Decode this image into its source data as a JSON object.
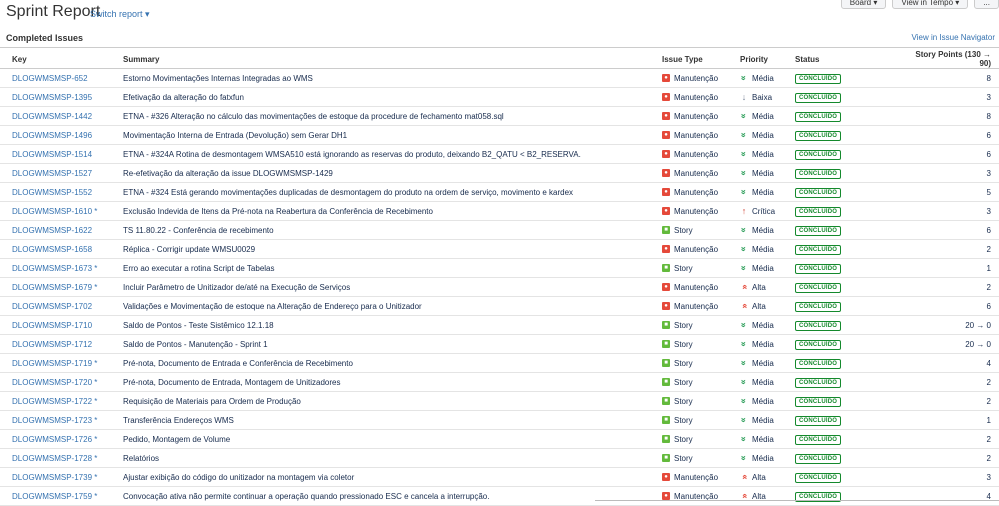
{
  "header": {
    "title": "Sprint Report",
    "switch_report": "Switch report ▾",
    "board_button": "Board ▾",
    "tempo_button": "View in Tempo ▾",
    "more_button": "..."
  },
  "section": {
    "title": "Completed Issues",
    "navigator_link": "View in Issue Navigator"
  },
  "columns": {
    "key": "Key",
    "summary": "Summary",
    "issue_type": "Issue Type",
    "priority": "Priority",
    "status": "Status",
    "story_points": "Story Points (130 → 90)"
  },
  "colors": {
    "link": "#3572b0",
    "manutencao_icon": "#e5493a",
    "story_icon": "#63ba3c",
    "status_green": "#14892c",
    "priority_media": "#2a9d58",
    "priority_baixa": "#7a869a",
    "priority_alta": "#e5493a",
    "priority_critica": "#d04437"
  },
  "icons": {
    "manutencao": "bug-icon",
    "story": "story-icon",
    "media": "double-chevron-down-icon",
    "baixa": "arrow-down-icon",
    "alta": "double-chevron-up-icon",
    "critica": "arrow-up-icon"
  },
  "rows": [
    {
      "key": "DLOGWMSMSP-652",
      "summary": "Estorno Movimentações Internas Integradas ao WMS",
      "type": "Manutenção",
      "priority": "Média",
      "status": "CONCLUÍDO",
      "points": "8"
    },
    {
      "key": "DLOGWMSMSP-1395",
      "summary": "Efetivação da alteração do fatxfun",
      "type": "Manutenção",
      "priority": "Baixa",
      "status": "CONCLUÍDO",
      "points": "3"
    },
    {
      "key": "DLOGWMSMSP-1442",
      "summary": "ETNA - #326 Alteração no cálculo das movimentações de estoque da procedure de fechamento mat058.sql",
      "type": "Manutenção",
      "priority": "Média",
      "status": "CONCLUÍDO",
      "points": "8"
    },
    {
      "key": "DLOGWMSMSP-1496",
      "summary": "Movimentação Interna de Entrada (Devolução) sem Gerar DH1",
      "type": "Manutenção",
      "priority": "Média",
      "status": "CONCLUÍDO",
      "points": "6"
    },
    {
      "key": "DLOGWMSMSP-1514",
      "summary": "ETNA - #324A Rotina de desmontagem WMSA510 está ignorando as reservas do produto, deixando B2_QATU < B2_RESERVA.",
      "type": "Manutenção",
      "priority": "Média",
      "status": "CONCLUÍDO",
      "points": "6"
    },
    {
      "key": "DLOGWMSMSP-1527",
      "summary": "Re-efetivação da alteração da issue DLOGWMSMSP-1429",
      "type": "Manutenção",
      "priority": "Média",
      "status": "CONCLUÍDO",
      "points": "3"
    },
    {
      "key": "DLOGWMSMSP-1552",
      "summary": "ETNA - #324 Está gerando movimentações duplicadas de desmontagem do produto na ordem de serviço, movimento e kardex",
      "type": "Manutenção",
      "priority": "Média",
      "status": "CONCLUÍDO",
      "points": "5"
    },
    {
      "key": "DLOGWMSMSP-1610 *",
      "summary": "Exclusão Indevida de Itens da Pré-nota na Reabertura da Conferência de Recebimento",
      "type": "Manutenção",
      "priority": "Crítica",
      "status": "CONCLUÍDO",
      "points": "3"
    },
    {
      "key": "DLOGWMSMSP-1622",
      "summary": "TS 11.80.22 - Conferência de recebimento",
      "type": "Story",
      "priority": "Média",
      "status": "CONCLUÍDO",
      "points": "6"
    },
    {
      "key": "DLOGWMSMSP-1658",
      "summary": "Réplica - Corrigir update WMSU0029",
      "type": "Manutenção",
      "priority": "Média",
      "status": "CONCLUÍDO",
      "points": "2"
    },
    {
      "key": "DLOGWMSMSP-1673 *",
      "summary": "Erro ao executar a rotina Script de Tabelas",
      "type": "Story",
      "priority": "Média",
      "status": "CONCLUÍDO",
      "points": "1"
    },
    {
      "key": "DLOGWMSMSP-1679 *",
      "summary": "Incluir Parâmetro de Unitizador de/até na Execução de Serviços",
      "type": "Manutenção",
      "priority": "Alta",
      "status": "CONCLUÍDO",
      "points": "2"
    },
    {
      "key": "DLOGWMSMSP-1702",
      "summary": "Validações e Movimentação de estoque na Alteração de Endereço para o Unitizador",
      "type": "Manutenção",
      "priority": "Alta",
      "status": "CONCLUÍDO",
      "points": "6"
    },
    {
      "key": "DLOGWMSMSP-1710",
      "summary": "Saldo de Pontos - Teste Sistêmico 12.1.18",
      "type": "Story",
      "priority": "Média",
      "status": "CONCLUÍDO",
      "points": "20 → 0"
    },
    {
      "key": "DLOGWMSMSP-1712",
      "summary": "Saldo de Pontos - Manutenção - Sprint 1",
      "type": "Story",
      "priority": "Média",
      "status": "CONCLUÍDO",
      "points": "20 → 0"
    },
    {
      "key": "DLOGWMSMSP-1719 *",
      "summary": "Pré-nota, Documento de Entrada e Conferência de Recebimento",
      "type": "Story",
      "priority": "Média",
      "status": "CONCLUÍDO",
      "points": "4"
    },
    {
      "key": "DLOGWMSMSP-1720 *",
      "summary": "Pré-nota, Documento de Entrada, Montagem de Unitizadores",
      "type": "Story",
      "priority": "Média",
      "status": "CONCLUÍDO",
      "points": "2"
    },
    {
      "key": "DLOGWMSMSP-1722 *",
      "summary": "Requisição de Materiais para Ordem de Produção",
      "type": "Story",
      "priority": "Média",
      "status": "CONCLUÍDO",
      "points": "2"
    },
    {
      "key": "DLOGWMSMSP-1723 *",
      "summary": "Transferência Endereços WMS",
      "type": "Story",
      "priority": "Média",
      "status": "CONCLUÍDO",
      "points": "1"
    },
    {
      "key": "DLOGWMSMSP-1726 *",
      "summary": "Pedido, Montagem de Volume",
      "type": "Story",
      "priority": "Média",
      "status": "CONCLUÍDO",
      "points": "2"
    },
    {
      "key": "DLOGWMSMSP-1728 *",
      "summary": "Relatórios",
      "type": "Story",
      "priority": "Média",
      "status": "CONCLUÍDO",
      "points": "2"
    },
    {
      "key": "DLOGWMSMSP-1739 *",
      "summary": "Ajustar exibição do código do unitizador na montagem via coletor",
      "type": "Manutenção",
      "priority": "Alta",
      "status": "CONCLUÍDO",
      "points": "3"
    },
    {
      "key": "DLOGWMSMSP-1759 *",
      "summary": "Convocação ativa não permite continuar a operação quando pressionado ESC e cancela a interrupção.",
      "type": "Manutenção",
      "priority": "Alta",
      "status": "CONCLUÍDO",
      "points": "4"
    }
  ]
}
